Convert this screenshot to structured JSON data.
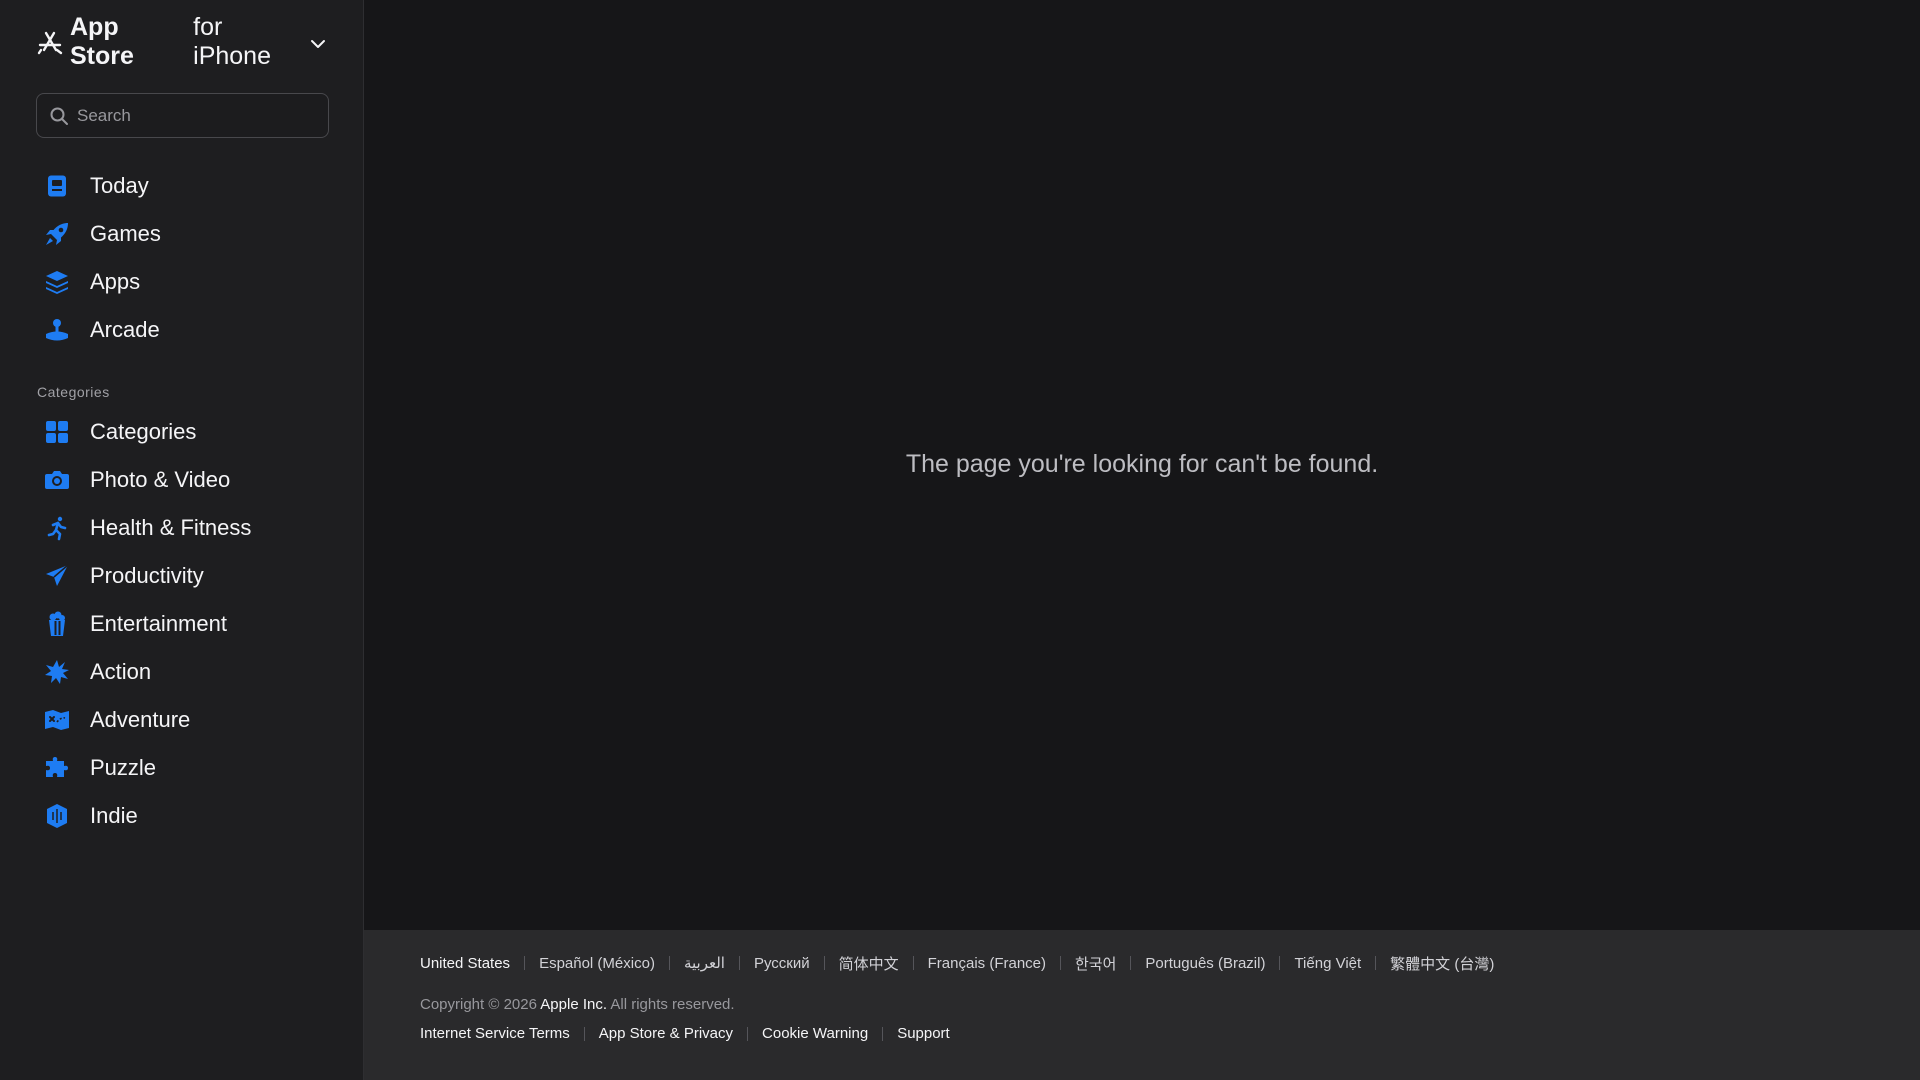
{
  "brand": {
    "store_label": "App Store",
    "for_label": "for iPhone",
    "logo_icon": "app-store-icon",
    "dropdown_icon": "chevron-down-icon"
  },
  "search": {
    "placeholder": "Search",
    "value": ""
  },
  "nav": {
    "items": [
      {
        "label": "Today",
        "icon": "today-icon"
      },
      {
        "label": "Games",
        "icon": "rocket-icon"
      },
      {
        "label": "Apps",
        "icon": "apps-stack-icon"
      },
      {
        "label": "Arcade",
        "icon": "joystick-icon"
      }
    ]
  },
  "categories": {
    "section_label": "Categories",
    "items": [
      {
        "label": "Categories",
        "icon": "grid-icon"
      },
      {
        "label": "Photo & Video",
        "icon": "camera-icon"
      },
      {
        "label": "Health & Fitness",
        "icon": "running-icon"
      },
      {
        "label": "Productivity",
        "icon": "paper-plane-icon"
      },
      {
        "label": "Entertainment",
        "icon": "popcorn-icon"
      },
      {
        "label": "Action",
        "icon": "explosion-icon"
      },
      {
        "label": "Adventure",
        "icon": "map-icon"
      },
      {
        "label": "Puzzle",
        "icon": "puzzle-icon"
      },
      {
        "label": "Indie",
        "icon": "indie-icon"
      }
    ]
  },
  "main": {
    "message": "The page you're looking for can't be found."
  },
  "footer": {
    "languages": [
      "United States",
      "Español (México)",
      "العربية",
      "Русский",
      "简体中文",
      "Français (France)",
      "한국어",
      "Português (Brazil)",
      "Tiếng Việt",
      "繁體中文 (台灣)"
    ],
    "copyright_prefix": "Copyright © 2026 ",
    "company": "Apple Inc.",
    "copyright_suffix": " All rights reserved.",
    "legal_links": [
      "Internet Service Terms",
      "App Store & Privacy",
      "Cookie Warning",
      "Support"
    ]
  },
  "colors": {
    "accent": "#1e7cf2",
    "sidebar_bg": "#1e1e20",
    "main_bg": "#161618",
    "footer_bg": "#2a2a2c"
  }
}
